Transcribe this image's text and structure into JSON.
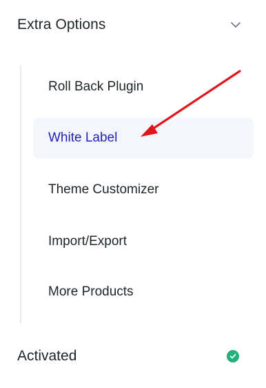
{
  "section": {
    "title": "Extra Options",
    "toggle_icon": "chevron-down-icon"
  },
  "menu": {
    "items": [
      {
        "label": "Roll Back Plugin",
        "active": false
      },
      {
        "label": "White Label",
        "active": true
      },
      {
        "label": "Theme Customizer",
        "active": false
      },
      {
        "label": "Import/Export",
        "active": false
      },
      {
        "label": "More Products",
        "active": false
      }
    ]
  },
  "status": {
    "label": "Activated",
    "icon": "check-circle-icon"
  },
  "colors": {
    "active_text": "#2521b1",
    "active_background": "#f3f6fd",
    "annotation_arrow": "#e0141b",
    "status_check": "#22b07d",
    "tree_line": "#e6e8ec"
  }
}
